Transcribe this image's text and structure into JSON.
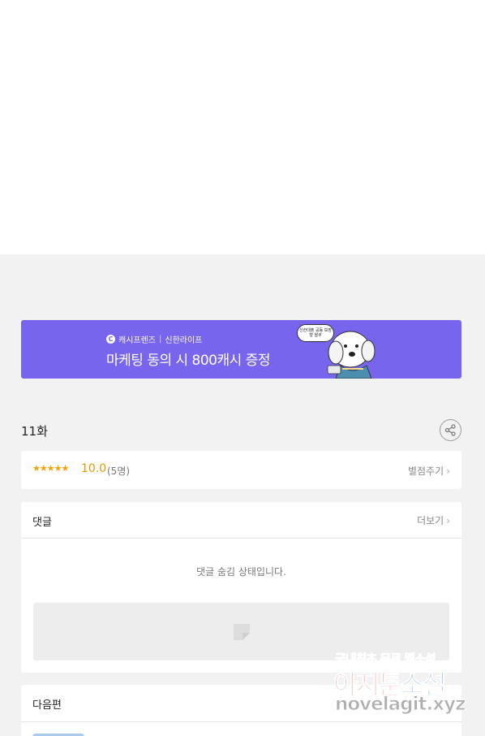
{
  "banner": {
    "brand_name": "캐시프렌즈",
    "partner": "신한라이프",
    "title": "마케팅 동의 시 800캐시 증정",
    "speech_bubble": "신한대출 공동 보장형 쌀쿠",
    "background_color": "#7765ee"
  },
  "episode": {
    "title": "11화",
    "share_icon": "share-icon"
  },
  "rating": {
    "stars": "★★★★★",
    "star_count": 5,
    "score": "10.0",
    "participants": "(5명)",
    "rate_link": "별점주기",
    "accent_color": "#f5a200"
  },
  "comments": {
    "title": "댓글",
    "more_link": "더보기",
    "hidden_message": "댓글 숨김 상태입니다."
  },
  "next": {
    "title": "다음편"
  },
  "watermark": {
    "line1_a": "국내최초 무료",
    "line1_b": "웹소설",
    "line2_a": "아지툰",
    "line2_b": "소설",
    "line3": "novelagit.xyz"
  }
}
